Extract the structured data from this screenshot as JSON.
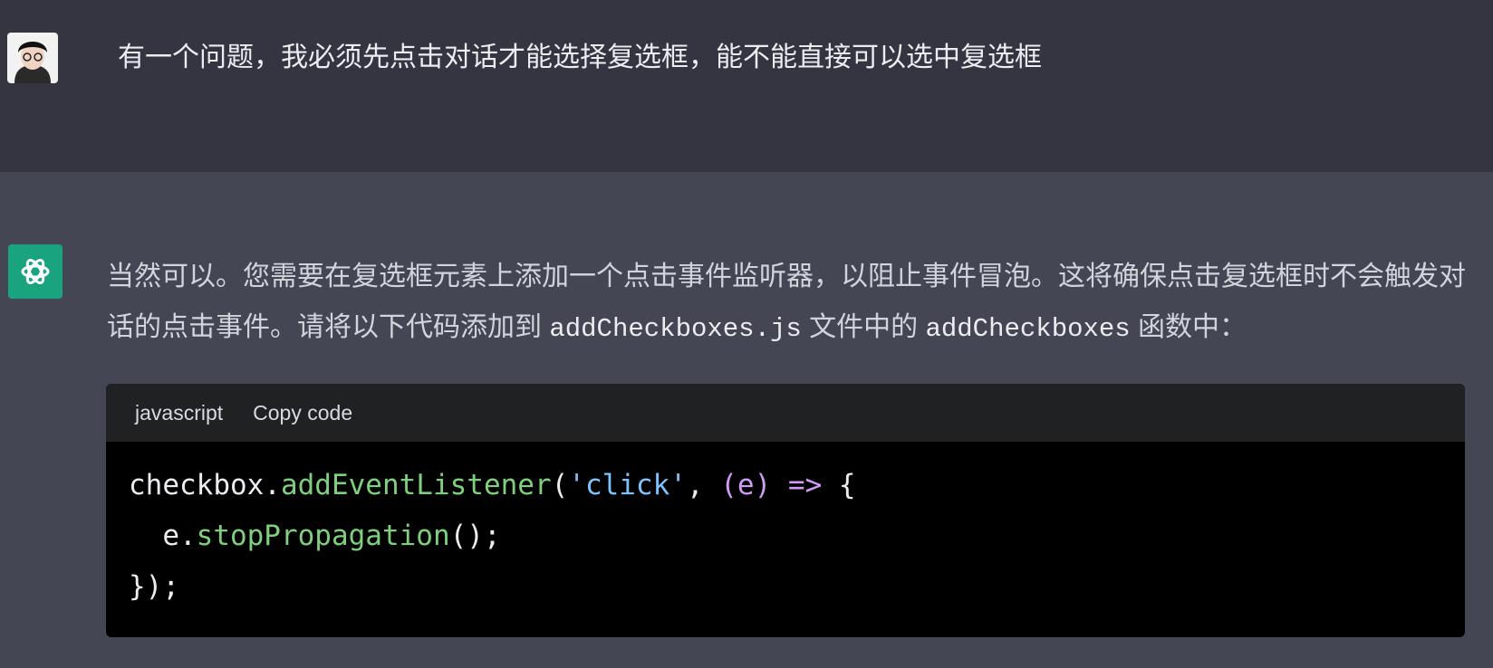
{
  "user_message": {
    "text": "有一个问题，我必须先点击对话才能选择复选框，能不能直接可以选中复选框"
  },
  "assistant_message": {
    "text_part1": "当然可以。您需要在复选框元素上添加一个点击事件监听器，以阻止事件冒泡。这将确保点击复选框时不会触发对话的点击事件。请将以下代码添加到 ",
    "code_file": "addCheckboxes.js",
    "text_part2": " 文件中的 ",
    "code_func": "addCheckboxes",
    "text_part3": " 函数中："
  },
  "code_block": {
    "language": "javascript",
    "copy_label": "Copy code",
    "line1": {
      "obj": "checkbox.",
      "method": "addEventListener",
      "open": "(",
      "str": "'click'",
      "comma": ", ",
      "param": "(e)",
      "arrow": " =>",
      "brace": " {"
    },
    "line2": {
      "indent": "  e.",
      "method": "stopPropagation",
      "end": "();"
    },
    "line3": "});"
  },
  "colors": {
    "user_bg": "#343541",
    "assistant_bg": "#444654",
    "gpt_brand": "#19a37f",
    "code_fn": "#7ed07e",
    "code_string": "#7ec3ff",
    "code_param": "#d19bf5"
  }
}
